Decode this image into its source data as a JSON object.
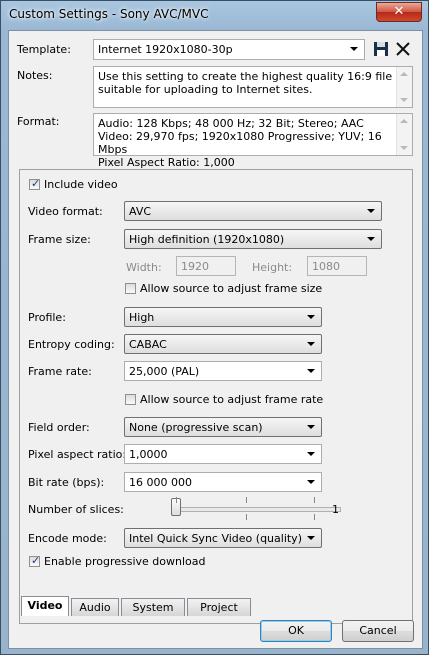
{
  "window": {
    "title": "Custom Settings - Sony AVC/MVC",
    "close_glyph": "✕"
  },
  "template": {
    "label": "Template:",
    "value": "Internet 1920x1080-30p",
    "save_icon": "save-icon",
    "delete_icon": "delete-icon"
  },
  "notes": {
    "label": "Notes:",
    "text": "Use this setting to create the highest quality 16:9 file suitable for uploading to Internet sites."
  },
  "format": {
    "label": "Format:",
    "lines": [
      "Audio: 128 Kbps; 48 000 Hz; 32 Bit; Stereo; AAC",
      "Video: 29,970 fps; 1920x1080 Progressive; YUV; 16 Mbps",
      "Pixel Aspect Ratio: 1,000"
    ]
  },
  "video": {
    "include_video": {
      "label": "Include video",
      "checked": true
    },
    "video_format": {
      "label": "Video format:",
      "value": "AVC"
    },
    "frame_size": {
      "label": "Frame size:",
      "value": "High definition (1920x1080)"
    },
    "width": {
      "label": "Width:",
      "value": "1920"
    },
    "height": {
      "label": "Height:",
      "value": "1080"
    },
    "allow_frame_size": {
      "label": "Allow source to adjust frame size",
      "checked": false
    },
    "profile": {
      "label": "Profile:",
      "value": "High"
    },
    "entropy": {
      "label": "Entropy coding:",
      "value": "CABAC"
    },
    "frame_rate": {
      "label": "Frame rate:",
      "value": "25,000 (PAL)"
    },
    "allow_frame_rate": {
      "label": "Allow source to adjust frame rate",
      "checked": false
    },
    "field_order": {
      "label": "Field order:",
      "value": "None (progressive scan)"
    },
    "pixel_aspect": {
      "label": "Pixel aspect ratio:",
      "value": "1,0000"
    },
    "bit_rate": {
      "label": "Bit rate (bps):",
      "value": "16 000 000"
    },
    "slices": {
      "label": "Number of slices:",
      "value": "1"
    },
    "encode_mode": {
      "label": "Encode mode:",
      "value": "Intel Quick Sync Video (quality)"
    },
    "progressive_download": {
      "label": "Enable progressive download",
      "checked": true
    }
  },
  "tabs": [
    "Video",
    "Audio",
    "System",
    "Project"
  ],
  "buttons": {
    "ok": "OK",
    "cancel": "Cancel"
  },
  "colors": {
    "titlebar": "#9ab8d4",
    "close": "#c8452f",
    "default_button_border": "#3c7fb1"
  }
}
